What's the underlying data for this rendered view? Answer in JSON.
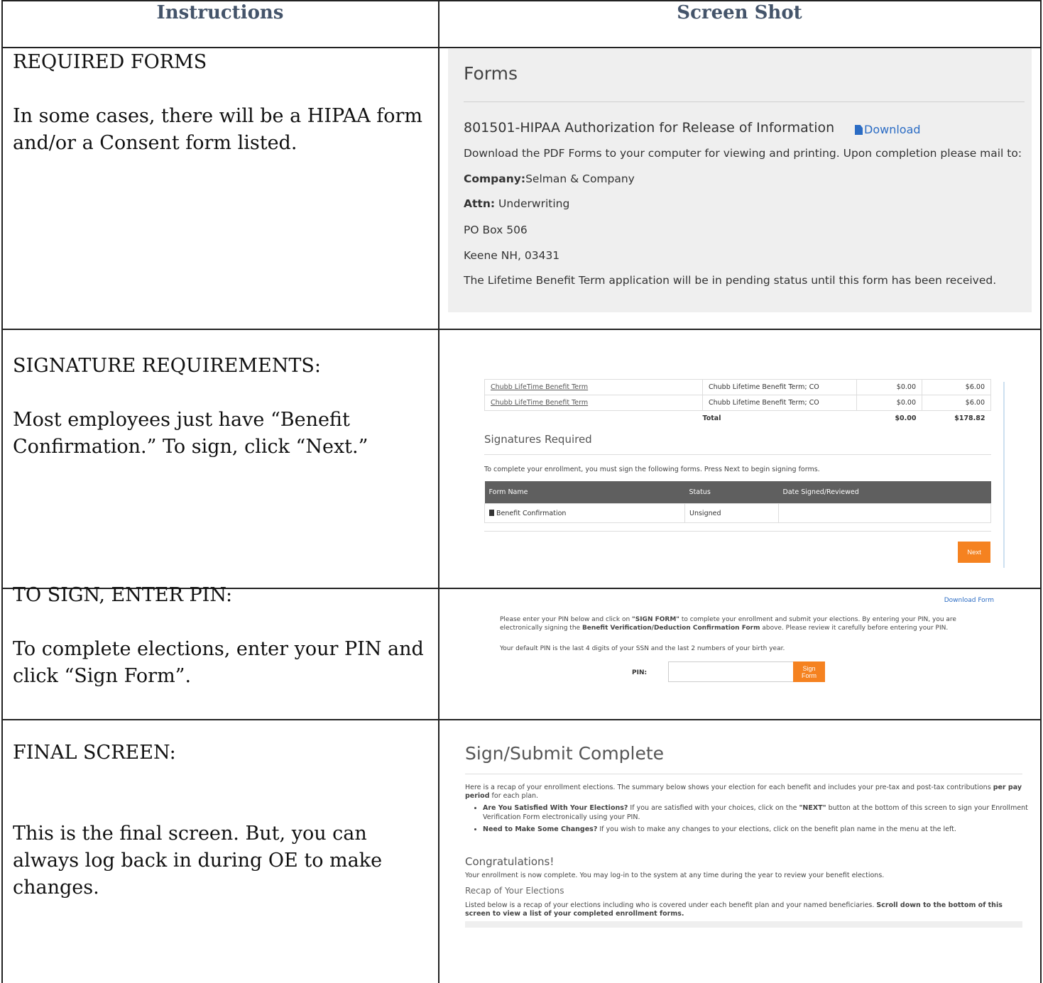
{
  "headers": {
    "instructions": "Instructions",
    "screenshot": "Screen Shot"
  },
  "rows": [
    {
      "heading": "REQUIRED FORMS",
      "text": "In some cases, there will be a HIPAA form and/or a Consent form listed."
    },
    {
      "heading": "SIGNATURE REQUIREMENTS:",
      "text": "Most employees just have “Benefit Confirmation.”  To sign, click “Next.”"
    },
    {
      "heading": "TO SIGN, ENTER PIN:",
      "text": "To complete elections, enter your PIN and click “Sign Form”."
    },
    {
      "heading": "FINAL SCREEN:",
      "text": "This is the final screen.  But, you can always log back in during OE to make changes."
    }
  ],
  "forms": {
    "title": "Forms",
    "form_name": "801501-HIPAA Authorization for Release of Information",
    "download": "Download",
    "instructions": "Download the PDF Forms to your computer for viewing and printing. Upon completion please mail to:",
    "company_label": "Company:",
    "company": "Selman & Company",
    "attn_label": "Attn:",
    "attn": " Underwriting",
    "po": "PO Box 506",
    "city": "Keene NH, 03431",
    "pending": "The Lifetime Benefit Term application will be in pending status until this form has been received."
  },
  "signatures": {
    "rows": [
      {
        "plan": "Chubb LifeTime Benefit Term",
        "coverage": "Chubb Lifetime Benefit Term; CO",
        "c1": "$0.00",
        "c2": "$6.00"
      },
      {
        "plan": "Chubb LifeTime Benefit Term",
        "coverage": "Chubb Lifetime Benefit Term; CO",
        "c1": "$0.00",
        "c2": "$6.00"
      }
    ],
    "total_label": "Total",
    "total1": "$0.00",
    "total2": "$178.82",
    "title": "Signatures Required",
    "text": "To complete your enrollment, you must sign the following forms. Press Next to begin signing forms.",
    "col_form": "Form Name",
    "col_status": "Status",
    "col_date": "Date Signed/Reviewed",
    "form": "Benefit Confirmation",
    "status": "Unsigned",
    "next": "Next"
  },
  "pin": {
    "download_form": "Download Form",
    "p1a": "Please enter your PIN below and click on ",
    "p1b": "\"SIGN FORM\"",
    "p1c": " to complete your enrollment and submit your elections. By entering your PIN, you are electronically signing the ",
    "p1d": "Benefit Verification/Deduction Confirmation Form",
    "p1e": " above. Please review it carefully before entering your PIN.",
    "p2": "Your default PIN is the last 4 digits of your SSN and the last 2 numbers of your birth year.",
    "label": "PIN:",
    "button": "Sign Form"
  },
  "final": {
    "title": "Sign/Submit Complete",
    "intro_a": "Here is a recap of your enrollment elections. The summary below shows your election for each benefit and includes your pre-tax and post-tax contributions ",
    "intro_b": "per pay period",
    "intro_c": " for each plan.",
    "b1a": "Are You Satisfied With Your Elections?",
    "b1b": " If you are satisfied with your choices, click on the ",
    "b1c": "\"NEXT\"",
    "b1d": " button at the bottom of this screen to sign your Enrollment Verification Form electronically using your PIN.",
    "b2a": "Need to Make Some Changes?",
    "b2b": " If you wish to make any changes to your elections, click on the benefit plan name in the menu at the left.",
    "congrats": "Congratulations!",
    "enroll": "Your enrollment is now complete. You may log-in to the system at any time during the year to review your benefit elections.",
    "recap": "Recap of Your Elections",
    "listed_a": "Listed below is a recap of your elections including who is covered under each benefit plan and your named beneficiaries. ",
    "listed_b": "Scroll down to the bottom of this screen to view a list of your completed enrollment forms."
  }
}
